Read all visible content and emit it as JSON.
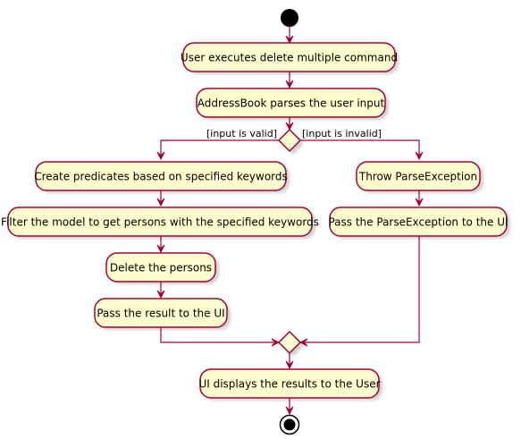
{
  "diagram": {
    "type": "activity",
    "colors": {
      "node_fill": "#FEFECE",
      "border": "#A80036",
      "start_end": "#000000"
    },
    "activities": {
      "user_executes": "User executes delete multiple command",
      "parse_input": "AddressBook parses the user input",
      "create_predicates": "Create predicates based on specified keywords",
      "filter_model": "Filter the model to get persons with the specified keywords",
      "delete_persons": "Delete the persons",
      "pass_result": "Pass the result to the UI",
      "throw_exception": "Throw ParseException",
      "pass_exception": "Pass the ParseException to the UI",
      "ui_displays": "UI displays the results to the User"
    },
    "guards": {
      "valid": "[input is valid]",
      "invalid": "[input is invalid]"
    }
  }
}
